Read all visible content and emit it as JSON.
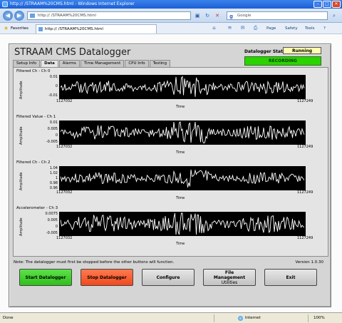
{
  "browser": {
    "window_title": "http://          /STRAAM%20CMS.html - Windows Internet Explorer",
    "address": "http://          /STRAAM%20CMS.html",
    "search_placeholder": "Google",
    "favorites_label": "Favorites",
    "tab_title": "http://          /STRAAM%20CMS.html",
    "page_menu": "Page",
    "safety_menu": "Safety",
    "tools_menu": "Tools",
    "help_menu": "?",
    "status_text": "Done",
    "zone_text": "Internet",
    "zoom_text": "100%"
  },
  "app": {
    "title": "STRAAM CMS Datalogger",
    "state_label": "Datalogger State",
    "state_value": "Running",
    "recording_label": "RECORDING",
    "tabs": [
      "Setup Info",
      "Data",
      "Alarms",
      "Time Management",
      "CPU Info",
      "Testing"
    ],
    "active_tab_index": 1,
    "note": "Note:  The datalogger must first be stopped before the other buttons will function.",
    "version": "Version 1.0.30",
    "buttons": {
      "start": "Start Datalogger",
      "stop": "Stop Datalogger",
      "configure": "Configure",
      "file_line1": "File",
      "file_line2": "Management",
      "file_line3": "Utilities",
      "exit": "Exit"
    }
  },
  "charts": [
    {
      "title": "Filtered Ch - Ch 0",
      "y_label": "Amplitude",
      "x_label": "Time",
      "y_ticks": [
        "0.01",
        "0",
        "-0.01"
      ],
      "x_start": "1127032",
      "x_end": "1127249"
    },
    {
      "title": "Filtered Value - Ch 1",
      "y_label": "Amplitude",
      "x_label": "Time",
      "y_ticks": [
        "0.01",
        "0.005",
        "0",
        "-0.005"
      ],
      "x_start": "1127032",
      "x_end": "1127249"
    },
    {
      "title": "Filtered Ch - Ch 2",
      "y_label": "Amplitude",
      "x_label": "Time",
      "y_ticks": [
        "1.04",
        "1.02",
        "1",
        "0.98",
        "0.96"
      ],
      "x_start": "1127032",
      "x_end": "1127249"
    },
    {
      "title": "Accelerometer - Ch 3",
      "y_label": "Amplitude",
      "x_label": "Time",
      "y_ticks": [
        "0.0075",
        "0.005",
        "0",
        "-0.005"
      ],
      "x_start": "1127032",
      "x_end": "1127249"
    }
  ],
  "colors": {
    "start_button": "#2fbf1b",
    "stop_button": "#f04a1d",
    "recording": "#2bd400",
    "state_value_bg": "#ffffb0",
    "plot_bg": "#000000",
    "trace": "#ffffff"
  }
}
